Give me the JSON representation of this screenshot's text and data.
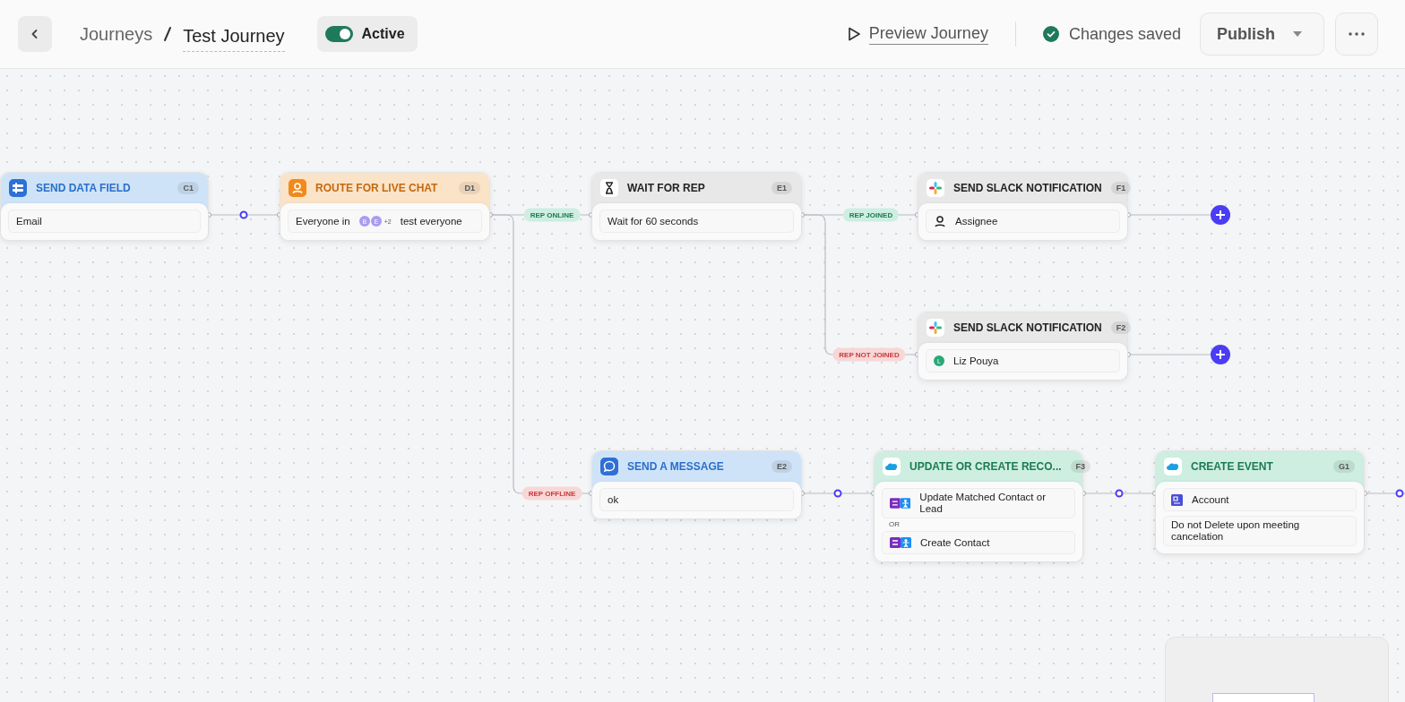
{
  "header": {
    "breadcrumb": [
      {
        "label": "Journeys"
      },
      {
        "label": "Test Journey"
      }
    ],
    "status": {
      "label": "Active",
      "on": true
    },
    "preview": "Preview Journey",
    "saved": "Changes saved",
    "publish": "Publish"
  },
  "nodes": [
    {
      "title": "SEND DATA FIELD",
      "tag": "C1",
      "kind": "field",
      "rows": [
        {
          "kind": "text",
          "text": "Email"
        }
      ]
    },
    {
      "title": "ROUTE FOR LIVE CHAT",
      "tag": "D1",
      "kind": "routing",
      "rows": [
        {
          "kind": "audience",
          "prefix": "Everyone in",
          "avatars": [
            "B",
            "E"
          ],
          "more": "+2",
          "text": "test everyone"
        }
      ]
    },
    {
      "title": "WAIT FOR REP",
      "tag": "E1",
      "kind": "wait",
      "rows": [
        {
          "kind": "text",
          "text": "Wait for 60 seconds"
        }
      ]
    },
    {
      "title": "SEND SLACK NOTIFICATION",
      "tag": "F1",
      "kind": "slack",
      "rows": [
        {
          "kind": "user",
          "text": "Assignee"
        }
      ]
    },
    {
      "title": "SEND SLACK NOTIFICATION",
      "tag": "F2",
      "kind": "slack",
      "rows": [
        {
          "kind": "person",
          "initial": "L",
          "text": "Liz Pouya"
        }
      ]
    },
    {
      "title": "SEND A MESSAGE",
      "tag": "E2",
      "kind": "message",
      "rows": [
        {
          "kind": "text",
          "text": "ok"
        }
      ]
    },
    {
      "title": "UPDATE OR CREATE RECO...",
      "tag": "F3",
      "kind": "salesforce",
      "rows": [
        {
          "kind": "object",
          "text": "Update Matched Contact or Lead"
        },
        {
          "kind": "divider",
          "text": "OR"
        },
        {
          "kind": "object",
          "text": "Create Contact"
        }
      ]
    },
    {
      "title": "CREATE EVENT",
      "tag": "G1",
      "kind": "salesforce",
      "rows": [
        {
          "kind": "record",
          "text": "Account"
        },
        {
          "kind": "text",
          "text": "Do not Delete upon meeting cancelation"
        }
      ]
    }
  ],
  "connections": [
    {
      "label": "REP ONLINE",
      "kind": "success"
    },
    {
      "label": "REP OFFLINE",
      "kind": "failure"
    },
    {
      "label": "REP JOINED",
      "kind": "success"
    },
    {
      "label": "REP NOT JOINED",
      "kind": "failure"
    }
  ]
}
